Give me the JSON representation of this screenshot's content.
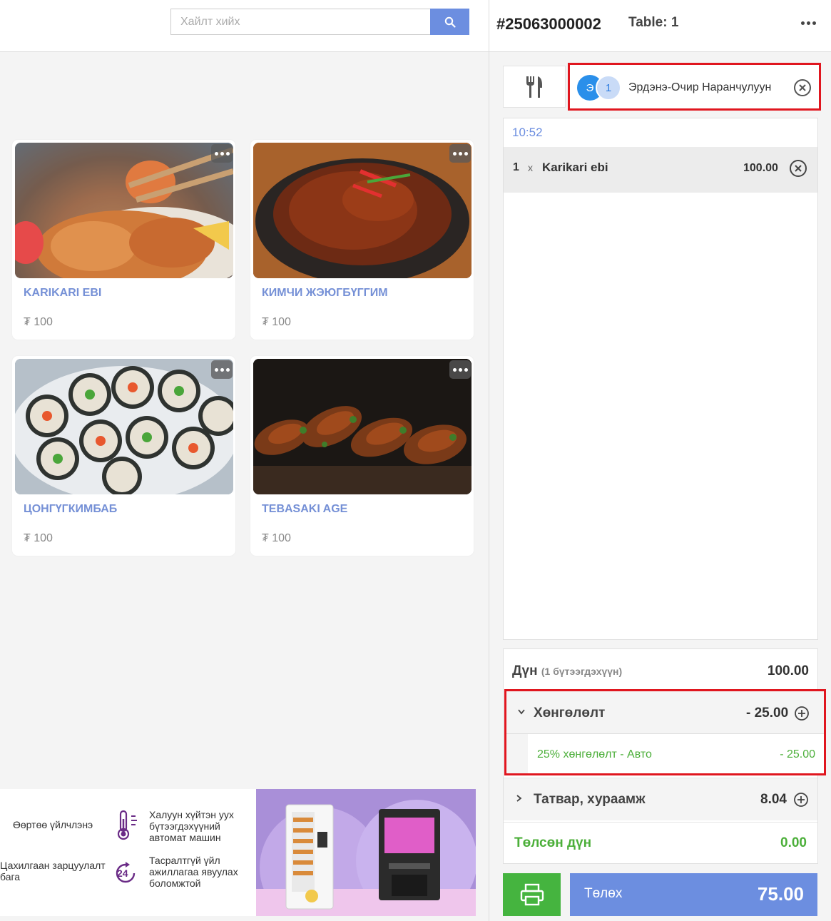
{
  "search": {
    "placeholder": "Хайлт хийх"
  },
  "products": [
    {
      "name": "KARIKARI EBI",
      "price": "₮ 100"
    },
    {
      "name": "КИМЧИ ЖЭЮГБҮГГИМ",
      "price": "₮ 100"
    },
    {
      "name": "ЦОНГҮГКИМБАБ",
      "price": "₮ 100"
    },
    {
      "name": "TEBASAKI AGE",
      "price": "₮ 100"
    }
  ],
  "banner": {
    "f1": "Өөртөө үйлчлэнэ",
    "f2": "Халуун хүйтэн уух бүтээгдэхүүний автомат машин",
    "f3": "Цахилгаан зарцуулалт бага",
    "f4": "Тасралтгүй үйл ажиллагаа явуулах боломжтой",
    "badge": "24"
  },
  "order": {
    "id": "#25063000002",
    "table": "Table: 1",
    "customer": {
      "avatar": "Э",
      "count": "1",
      "name": "Эрдэнэ-Очир Наранчулуун"
    },
    "time": "10:52",
    "items": [
      {
        "qty": "1",
        "x": "x",
        "name": "Karikari ebi",
        "amount": "100.00"
      }
    ]
  },
  "summary": {
    "subtotal_label": "Дүн",
    "subtotal_sub": "(1 бүтээгдэхүүн)",
    "subtotal": "100.00",
    "discount_label": "Хөнгөлөлт",
    "discount": "- 25.00",
    "discount_detail_label": "25% хөнгөлөлт - Авто",
    "discount_detail": "- 25.00",
    "tax_label": "Татвар, хураамж",
    "tax": "8.04",
    "paid_label": "Төлсөн дүн",
    "paid": "0.00"
  },
  "pay": {
    "label": "Төлөх",
    "amount": "75.00"
  },
  "colors": {
    "accent": "#6c8ee0",
    "green": "#45b43f",
    "highlight": "#e0161f"
  }
}
